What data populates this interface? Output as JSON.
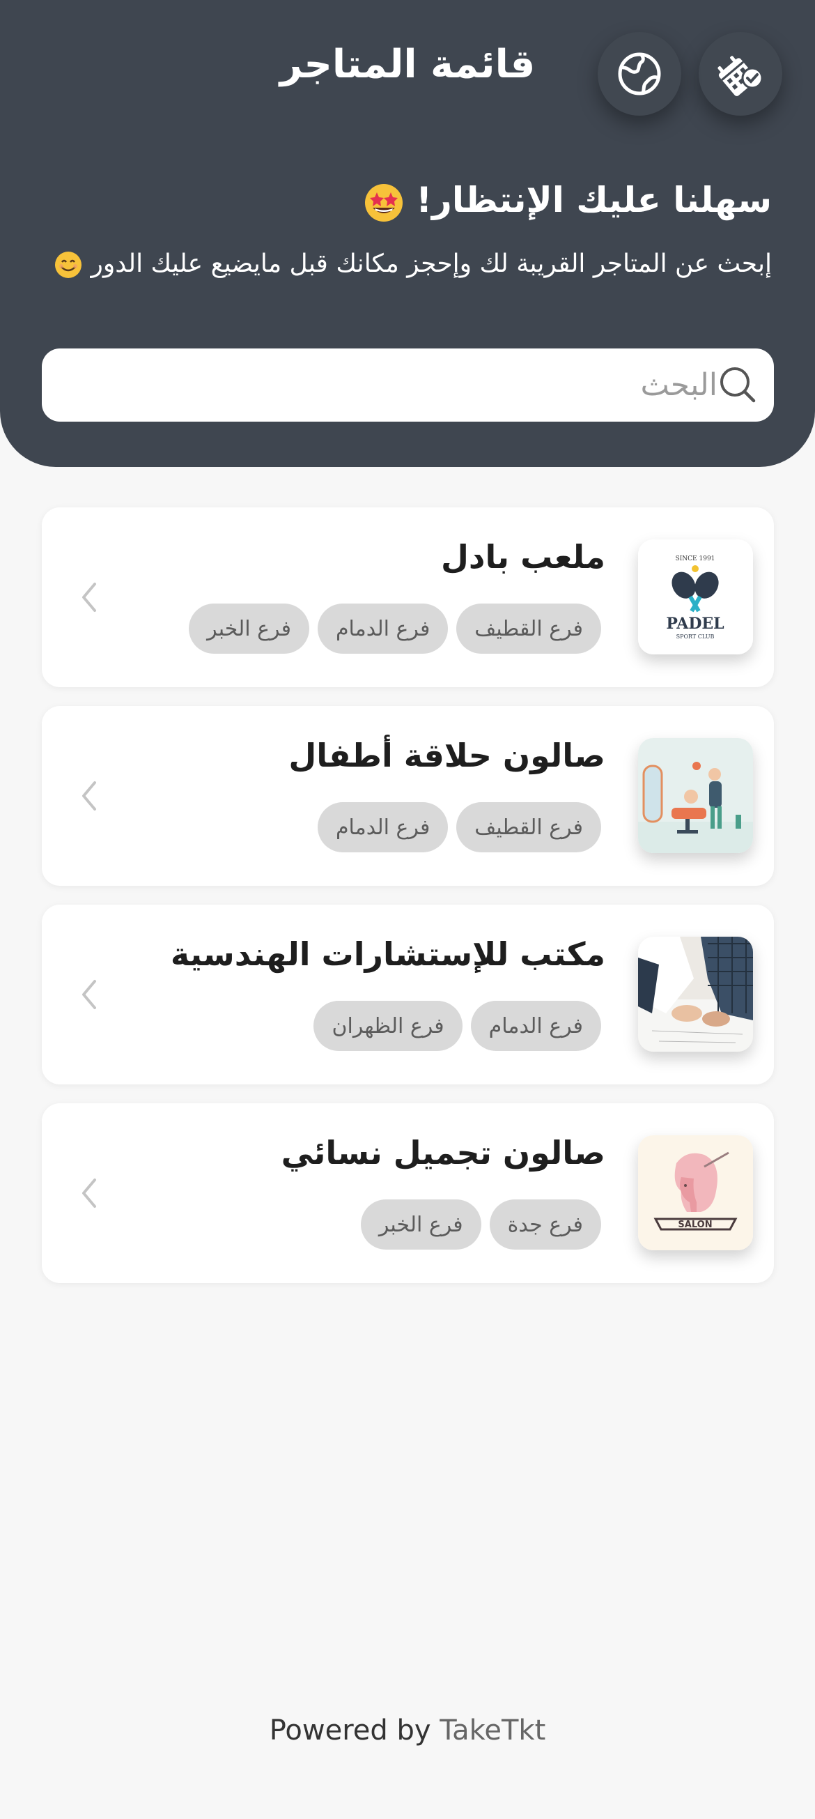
{
  "header": {
    "title": "قائمة المتاجر",
    "welcome": "سهلنا عليك الإنتظار!",
    "welcome_emoji": "star-struck-emoji",
    "subtitle": "إبحث عن المتاجر القريبة لك وإحجز مكانك قبل مايضيع عليك الدور",
    "subtitle_emoji": "smiling-emoji",
    "calendar_button_icon": "calendar-check-icon",
    "globe_button_icon": "globe-icon"
  },
  "search": {
    "placeholder": "البحث",
    "value": ""
  },
  "stores": [
    {
      "name": "ملعب بادل",
      "image": "padel-logo",
      "tags": [
        "فرع القطيف",
        "فرع الدمام",
        "فرع الخبر"
      ]
    },
    {
      "name": "صالون حلاقة أطفال",
      "image": "kids-barber-illustration",
      "tags": [
        "فرع القطيف",
        "فرع الدمام"
      ]
    },
    {
      "name": "مكتب للإستشارات الهندسية",
      "image": "engineering-office-photo",
      "tags": [
        "فرع الدمام",
        "فرع الظهران"
      ]
    },
    {
      "name": "صالون تجميل نسائي",
      "image": "salon-logo",
      "tags": [
        "فرع جدة",
        "فرع الخبر"
      ]
    }
  ],
  "logos": {
    "padel_since": "SINCE 1991",
    "padel_word": "PADEL",
    "padel_sub": "SPORT CLUB",
    "salon_word": "SALON"
  },
  "footer": {
    "prefix": "Powered by ",
    "brand": "TakeTkt"
  },
  "colors": {
    "header_bg": "#3f4650",
    "page_bg": "#f7f7f7",
    "tag_bg": "#d9d9d9"
  }
}
